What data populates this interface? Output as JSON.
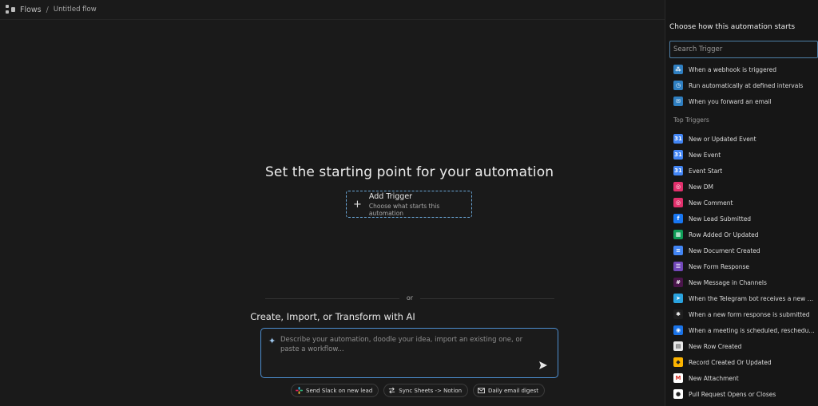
{
  "breadcrumb": {
    "root": "Flows",
    "separator": "/",
    "current": "Untitled flow"
  },
  "canvas": {
    "headline": "Set the starting point for your automation",
    "add_trigger": {
      "title": "Add Trigger",
      "subtitle": "Choose what starts this automation",
      "icon": "plus-icon"
    },
    "divider_text": "or",
    "ai_title": "Create, Import, or Transform with AI",
    "ai_input": {
      "placeholder": "Describe your automation, doodle your idea, import an existing one, or paste a workflow...",
      "value": ""
    },
    "suggestions": [
      {
        "label": "Send Slack on new lead",
        "icon": "slack-icon"
      },
      {
        "label": "Sync Sheets -> Notion",
        "icon": "swap-arrows-icon"
      },
      {
        "label": "Daily email digest",
        "icon": "mail-icon"
      }
    ]
  },
  "panel": {
    "title": "Choose how this automation starts",
    "search_placeholder": "Search Trigger",
    "basic_triggers": [
      {
        "label": "When a webhook is triggered",
        "icon": "webhook-icon",
        "color": "#2f7fc1"
      },
      {
        "label": "Run automatically at defined intervals",
        "icon": "clock-icon",
        "color": "#2f7fc1"
      },
      {
        "label": "When you forward an email",
        "icon": "mail-icon",
        "color": "#2f7fc1"
      }
    ],
    "section_label": "Top Triggers",
    "top_triggers": [
      {
        "label": "New or Updated Event",
        "icon": "google-calendar-icon",
        "color": "#4285f4"
      },
      {
        "label": "New Event",
        "icon": "google-calendar-icon",
        "color": "#4285f4"
      },
      {
        "label": "Event Start",
        "icon": "google-calendar-icon",
        "color": "#4285f4"
      },
      {
        "label": "New DM",
        "icon": "instagram-icon",
        "color": "#e1306c"
      },
      {
        "label": "New Comment",
        "icon": "instagram-icon",
        "color": "#e1306c"
      },
      {
        "label": "New Lead Submitted",
        "icon": "facebook-icon",
        "color": "#1877f2"
      },
      {
        "label": "Row Added Or Updated",
        "icon": "google-sheets-icon",
        "color": "#0f9d58"
      },
      {
        "label": "New Document Created",
        "icon": "google-docs-icon",
        "color": "#4285f4"
      },
      {
        "label": "New Form Response",
        "icon": "google-forms-icon",
        "color": "#7248b9"
      },
      {
        "label": "New Message in Channels",
        "icon": "slack-icon",
        "color": "#4a154b"
      },
      {
        "label": "When the Telegram bot receives a new m...",
        "icon": "telegram-icon",
        "color": "#2aa3df"
      },
      {
        "label": "When a new form response is submitted",
        "icon": "asterisk-icon",
        "color": "#1f1f1f"
      },
      {
        "label": "When a meeting is scheduled, reschedule...",
        "icon": "calendly-icon",
        "color": "#1a73e8"
      },
      {
        "label": "New Row Created",
        "icon": "table-icon",
        "color": "#e8e8e8"
      },
      {
        "label": "Record Created Or Updated",
        "icon": "airtable-icon",
        "color": "#fcb400"
      },
      {
        "label": "New Attachment",
        "icon": "gmail-icon",
        "color": "#ffffff"
      },
      {
        "label": "Pull Request Opens or Closes",
        "icon": "github-icon",
        "color": "#ffffff"
      }
    ]
  }
}
